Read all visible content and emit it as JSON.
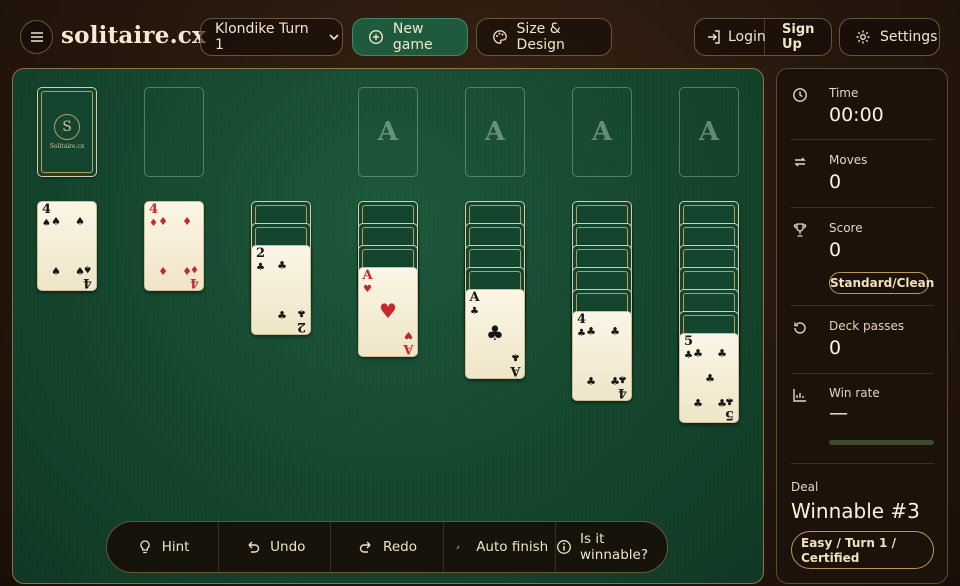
{
  "header": {
    "logo_text": "solitaire.cx",
    "game_select_value": "Klondike Turn 1",
    "new_game_label": "New game",
    "size_design_label": "Size & Design",
    "login_label": "Login",
    "signup_label": "Sign Up",
    "settings_label": "Settings"
  },
  "board": {
    "stock_logo_letter": "S",
    "stock_logo_text": "Solitaire.cx",
    "foundation_letter": "A",
    "tableau": [
      {
        "hidden": 0,
        "rank": "4",
        "suit": "♠",
        "color": "black"
      },
      {
        "hidden": 0,
        "rank": "4",
        "suit": "♦",
        "color": "red"
      },
      {
        "hidden": 2,
        "rank": "2",
        "suit": "♣",
        "color": "black"
      },
      {
        "hidden": 3,
        "rank": "A",
        "suit": "♥",
        "color": "red"
      },
      {
        "hidden": 4,
        "rank": "A",
        "suit": "♣",
        "color": "black"
      },
      {
        "hidden": 5,
        "rank": "4",
        "suit": "♣",
        "color": "black"
      },
      {
        "hidden": 6,
        "rank": "5",
        "suit": "♣",
        "color": "black"
      }
    ]
  },
  "toolbar": {
    "hint_label": "Hint",
    "undo_label": "Undo",
    "redo_label": "Redo",
    "auto_finish_label": "Auto finish",
    "winnable_label": "Is it winnable?"
  },
  "sidebar": {
    "time_label": "Time",
    "time_value": "00:00",
    "moves_label": "Moves",
    "moves_value": "0",
    "score_label": "Score",
    "score_value": "0",
    "score_mode": "Standard/Clean",
    "passes_label": "Deck passes",
    "passes_value": "0",
    "winrate_label": "Win rate",
    "winrate_value": "—",
    "deal_label": "Deal",
    "deal_value": "Winnable #3",
    "deal_badge_line1": "Easy / Turn 1 /",
    "deal_badge_line2": "Certified"
  },
  "colors": {
    "felt": "#1a5035",
    "gold": "#b9965a",
    "card_red": "#c42a2a",
    "accent_green": "#1f5a3e"
  }
}
